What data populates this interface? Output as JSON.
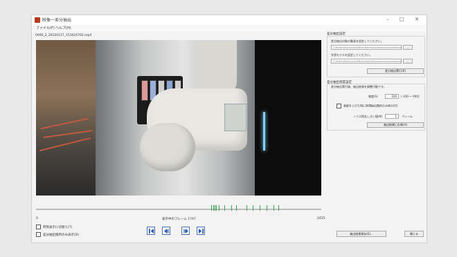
{
  "window": {
    "title": "映像一差分抽出",
    "controls": {
      "minimize": "–",
      "maximize": "□",
      "close": "✕"
    }
  },
  "menu": {
    "file": "ファイル(F)",
    "help": "ヘルプ(H)"
  },
  "video": {
    "file_name": "0946_2_20220127_151616702.mp4",
    "start_frame": "0",
    "end_frame": "2425",
    "current_frame_label": "表示中のフレーム 1747"
  },
  "controls": {
    "option1": "時刻表示に切替え(T)",
    "option2": "差分抽出箇所のみ表示(D)",
    "nav": [
      "first-frame-icon",
      "prev-frame-icon",
      "next-frame-icon",
      "last-frame-icon"
    ]
  },
  "panel": {
    "section1_title": "差分抽出設定",
    "video_label": "差分抽出対象の動画を設定してください。",
    "video_path": "C:¥Users¥xxxxxxxx¥Documents¥xxxxxxxxxxxxxx¥xxxxxxxx",
    "model_label": "学習モデルを設定してください。",
    "model_path": "C:¥Users¥xxxxxxxx¥Documents¥xxxxxxxxxxxxxx¥model",
    "browse": "...",
    "run_button": "差分抽出実行(R)",
    "section2_title": "差分抽出感度設定",
    "section2_desc": "差分抽出実行後、抽出結果を調整可能です。",
    "sensitivity_label": "感度(S)",
    "sensitivity_value": "100",
    "sensitivity_range": "(-100 ～ 600)",
    "upper_only_label": "感度を上げた時に新規抽出箇所のみ表示(O)",
    "noise_label": "ノイズ除去しきい値(N)",
    "noise_value": "1",
    "noise_unit": "フレーム",
    "reapply_button": "抽出結果に反映(A)",
    "save_button": "抽出結果保存(E)...",
    "close_button": "閉じる"
  },
  "timeline_markers": [
    1490,
    1505,
    1520,
    1530,
    1555,
    1600,
    1660,
    1700,
    1790,
    1840,
    1900,
    1960,
    2020,
    2060
  ]
}
